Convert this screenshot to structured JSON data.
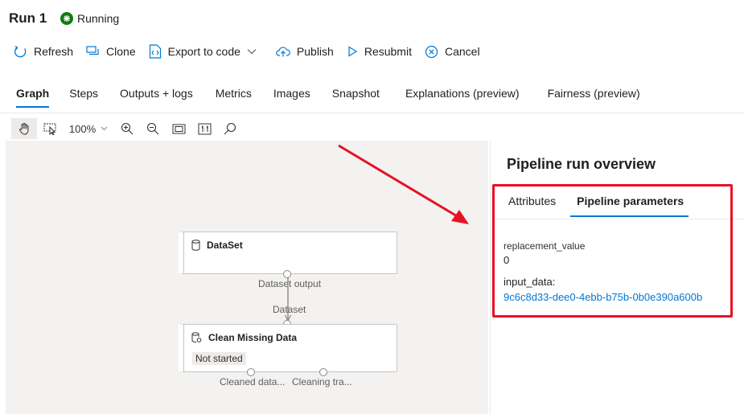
{
  "header": {
    "title": "Run 1",
    "status": "Running"
  },
  "toolbar": {
    "refresh": "Refresh",
    "clone": "Clone",
    "export": "Export to code",
    "publish": "Publish",
    "resubmit": "Resubmit",
    "cancel": "Cancel"
  },
  "tabs": [
    "Graph",
    "Steps",
    "Outputs + logs",
    "Metrics",
    "Images",
    "Snapshot",
    "Explanations (preview)",
    "Fairness (preview)"
  ],
  "canvas_toolbar": {
    "zoom": "100%"
  },
  "graph": {
    "dataset_node": {
      "title": "DataSet",
      "output_label": "Dataset output"
    },
    "edge_label": "Dataset",
    "clean_node": {
      "title": "Clean Missing Data",
      "status": "Not started",
      "output_1": "Cleaned data...",
      "output_2": "Cleaning tra..."
    }
  },
  "panel": {
    "title": "Pipeline run overview",
    "tabs": [
      "Attributes",
      "Pipeline parameters"
    ],
    "params": [
      {
        "label": "replacement_value",
        "value": "0"
      },
      {
        "label": "input_data:",
        "value": "9c6c8d33-dee0-4ebb-b75b-0b0e390a600b"
      }
    ]
  },
  "colors": {
    "accent": "#0078d4",
    "running": "#107c10",
    "highlight": "#e81123"
  }
}
